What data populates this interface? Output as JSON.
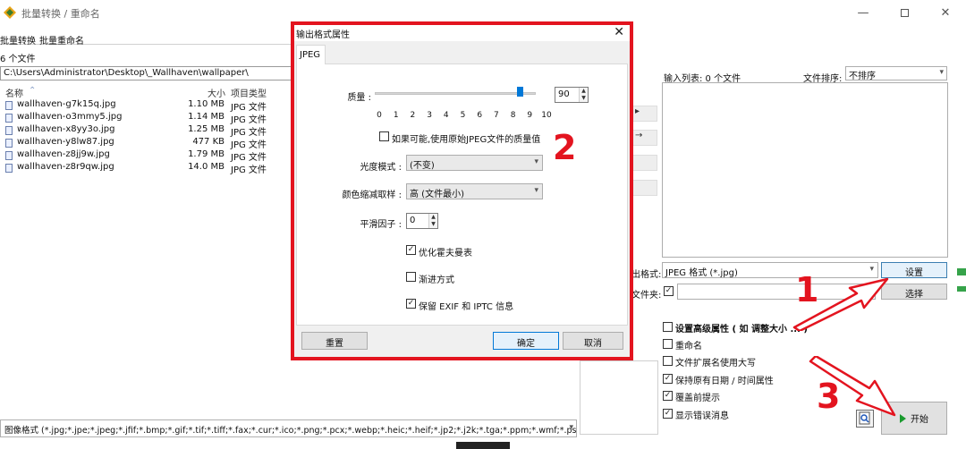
{
  "window": {
    "title": "批量转换 / 重命名",
    "tabs": [
      "批量转换",
      "批量重命名"
    ]
  },
  "file_panel": {
    "count_label": "6 个文件",
    "path": "C:\\Users\\Administrator\\Desktop\\_Wallhaven\\wallpaper\\",
    "columns": {
      "name": "名称",
      "size": "大小",
      "type": "项目类型"
    },
    "files": [
      {
        "name": "wallhaven-g7k15q.jpg",
        "size": "1.10 MB",
        "type": "JPG 文件"
      },
      {
        "name": "wallhaven-o3mmy5.jpg",
        "size": "1.14 MB",
        "type": "JPG 文件"
      },
      {
        "name": "wallhaven-x8yy3o.jpg",
        "size": "1.25 MB",
        "type": "JPG 文件"
      },
      {
        "name": "wallhaven-y8lw87.jpg",
        "size": "477 KB",
        "type": "JPG 文件"
      },
      {
        "name": "wallhaven-z8jj9w.jpg",
        "size": "1.79 MB",
        "type": "JPG 文件"
      },
      {
        "name": "wallhaven-z8r9qw.jpg",
        "size": "14.0 MB",
        "type": "JPG 文件"
      }
    ],
    "filter": "图像格式 (*.jpg;*.jpe;*.jpeg;*.jfif;*.bmp;*.gif;*.tif;*.tiff;*.fax;*.cur;*.ico;*.png;*.pcx;*.webp;*.heic;*.heif;*.jp2;*.j2k;*.tga;*.ppm;*.wmf;*.psd;*.crw;*.nef;*."
  },
  "right_panel": {
    "input_list_label": "输入列表: 0 个文件",
    "sort_label": "文件排序:",
    "sort_value": "不排序",
    "output_format_label": "出格式:",
    "output_format_value": "JPEG 格式 (*.jpg)",
    "settings_button": "设置",
    "folder_label": "文件夹:",
    "folder_checked": true,
    "choose_button": "选择",
    "options": [
      {
        "label": "设置高级属性 ( 如 调整大小 ... )",
        "checked": false
      },
      {
        "label": "重命名",
        "checked": false
      },
      {
        "label": "文件扩展名使用大写",
        "checked": false
      },
      {
        "label": "保持原有日期 / 时间属性",
        "checked": true
      },
      {
        "label": "覆盖前提示",
        "checked": true
      },
      {
        "label": "显示错误消息",
        "checked": true
      }
    ],
    "start_button": "开始"
  },
  "dialog": {
    "title": "输出格式属性",
    "tab": "JPEG",
    "quality_label": "质量 :",
    "quality_value": "90",
    "quality_fraction": 0.9,
    "quality_ticks": [
      "0",
      "1",
      "2",
      "3",
      "4",
      "5",
      "6",
      "7",
      "8",
      "9",
      "10"
    ],
    "use_original_quality": "如果可能,使用原始JPEG文件的质量值",
    "luma_label": "光度模式 :",
    "luma_value": "(不变)",
    "chroma_label": "颜色缩减取样 :",
    "chroma_value": "高 (文件最小)",
    "smoothing_label": "平滑因子 :",
    "smoothing_value": "0",
    "optimize_huffman": "优化霍夫曼表",
    "progressive": "渐进方式",
    "keep_exif": "保留 EXIF 和 IPTC 信息",
    "reset_button": "重置",
    "ok_button": "确定",
    "cancel_button": "取消"
  },
  "annotations": [
    "1",
    "2",
    "3"
  ],
  "colors": {
    "annotation_red": "#e3141f",
    "accent_blue": "#0078d7",
    "start_green": "#1a9a2e"
  }
}
